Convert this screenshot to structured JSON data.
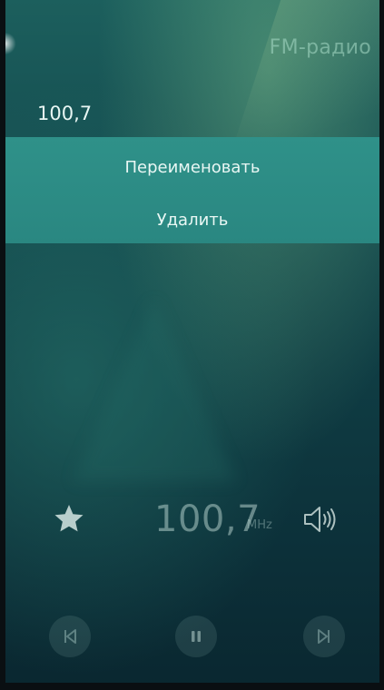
{
  "header": {
    "app_title": "FM-радио"
  },
  "station": {
    "name": "100,7"
  },
  "context_menu": {
    "items": [
      {
        "label": "Переименовать"
      },
      {
        "label": "Удалить"
      }
    ]
  },
  "player": {
    "frequency": "100,7",
    "unit": "MHz",
    "favorite_icon": "star-icon",
    "volume_icon": "speaker-icon"
  },
  "controls": {
    "prev_icon": "skip-previous-icon",
    "pause_icon": "pause-icon",
    "next_icon": "skip-next-icon"
  },
  "colors": {
    "menu_background": "#2f9189",
    "background_top": "#1c5f5d",
    "background_bottom": "#0a2730"
  }
}
